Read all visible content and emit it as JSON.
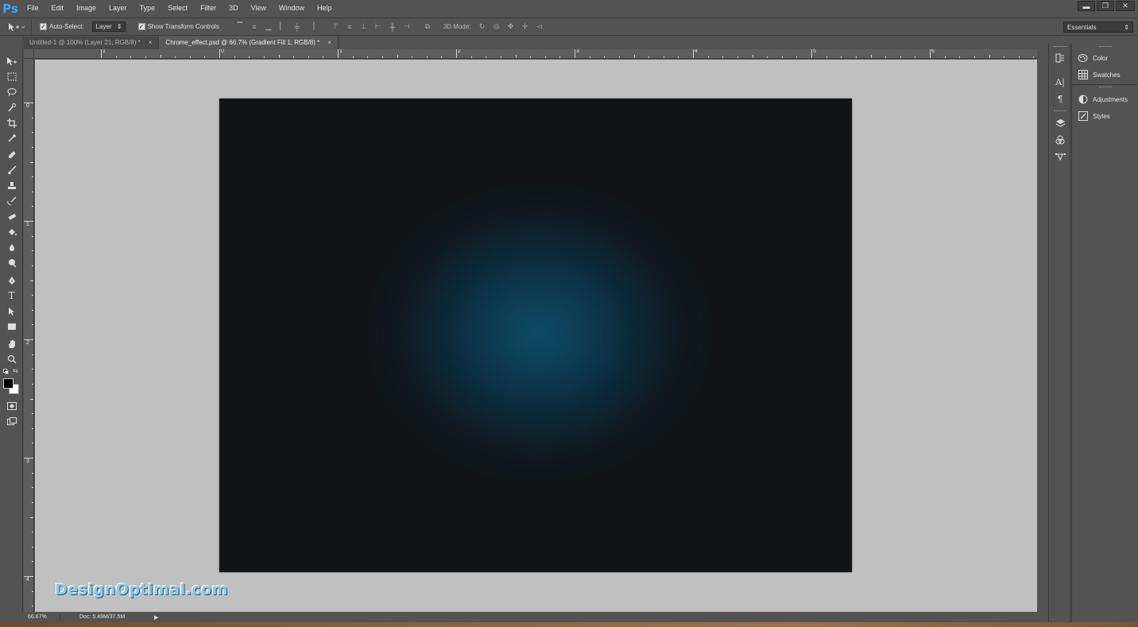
{
  "app": {
    "logo": "Ps"
  },
  "menu": [
    "File",
    "Edit",
    "Image",
    "Layer",
    "Type",
    "Select",
    "Filter",
    "3D",
    "View",
    "Window",
    "Help"
  ],
  "window_controls": {
    "minimize": "▬",
    "restore": "❐",
    "close": "✕"
  },
  "options_bar": {
    "auto_select_label": "Auto-Select:",
    "auto_select_checked": true,
    "auto_select_target": "Layer",
    "show_transform_label": "Show Transform Controls",
    "show_transform_checked": true,
    "mode_3d_label": "3D Mode:",
    "workspace": "Essentials"
  },
  "tabs": [
    {
      "label": "Untitled-1 @ 100% (Layer 21, RGB/8) *",
      "active": false
    },
    {
      "label": "Chrome_effect.psd @ 66.7% (Gradient Fill 1, RGB/8) *",
      "active": true
    }
  ],
  "tab_close": "×",
  "ruler": {
    "top_labels": [
      "1",
      "0",
      "1",
      "2",
      "3",
      "4",
      "5",
      "6"
    ],
    "left_labels": [
      "0",
      "1",
      "2",
      "3",
      "4"
    ]
  },
  "tools": [
    "move-tool-icon",
    "marquee-tool-icon",
    "lasso-tool-icon",
    "quick-select-tool-icon",
    "crop-tool-icon",
    "eyedropper-tool-icon",
    "healing-brush-tool-icon",
    "brush-tool-icon",
    "clone-stamp-tool-icon",
    "history-brush-tool-icon",
    "eraser-tool-icon",
    "paint-bucket-tool-icon",
    "blur-tool-icon",
    "dodge-tool-icon",
    "pen-tool-icon",
    "type-tool-icon",
    "path-selection-tool-icon",
    "rectangle-tool-icon",
    "hand-tool-icon",
    "zoom-tool-icon"
  ],
  "type_tool_glyph": "T",
  "colors": {
    "foreground": "#000000",
    "background": "#ffffff",
    "document_glow": "#0f4a67",
    "document_base": "#121416",
    "pasteboard": "#c0c0c0",
    "ui_dark": "#535353"
  },
  "panels": [
    {
      "label": "Color",
      "icon": "color-panel-icon"
    },
    {
      "label": "Swatches",
      "icon": "swatches-panel-icon"
    },
    {
      "label": "Adjustments",
      "icon": "adjustments-panel-icon"
    },
    {
      "label": "Styles",
      "icon": "styles-panel-icon"
    }
  ],
  "panel_icons": [
    "history-panel-icon",
    "character-panel-icon",
    "paragraph-panel-icon",
    "layers-panel-icon",
    "channels-panel-icon",
    "paths-panel-icon"
  ],
  "status": {
    "zoom": "66.67%",
    "doc_size": "Doc: 5.49M/37.5M",
    "arrow": "▶"
  },
  "watermark": "DesignOptimal.com"
}
